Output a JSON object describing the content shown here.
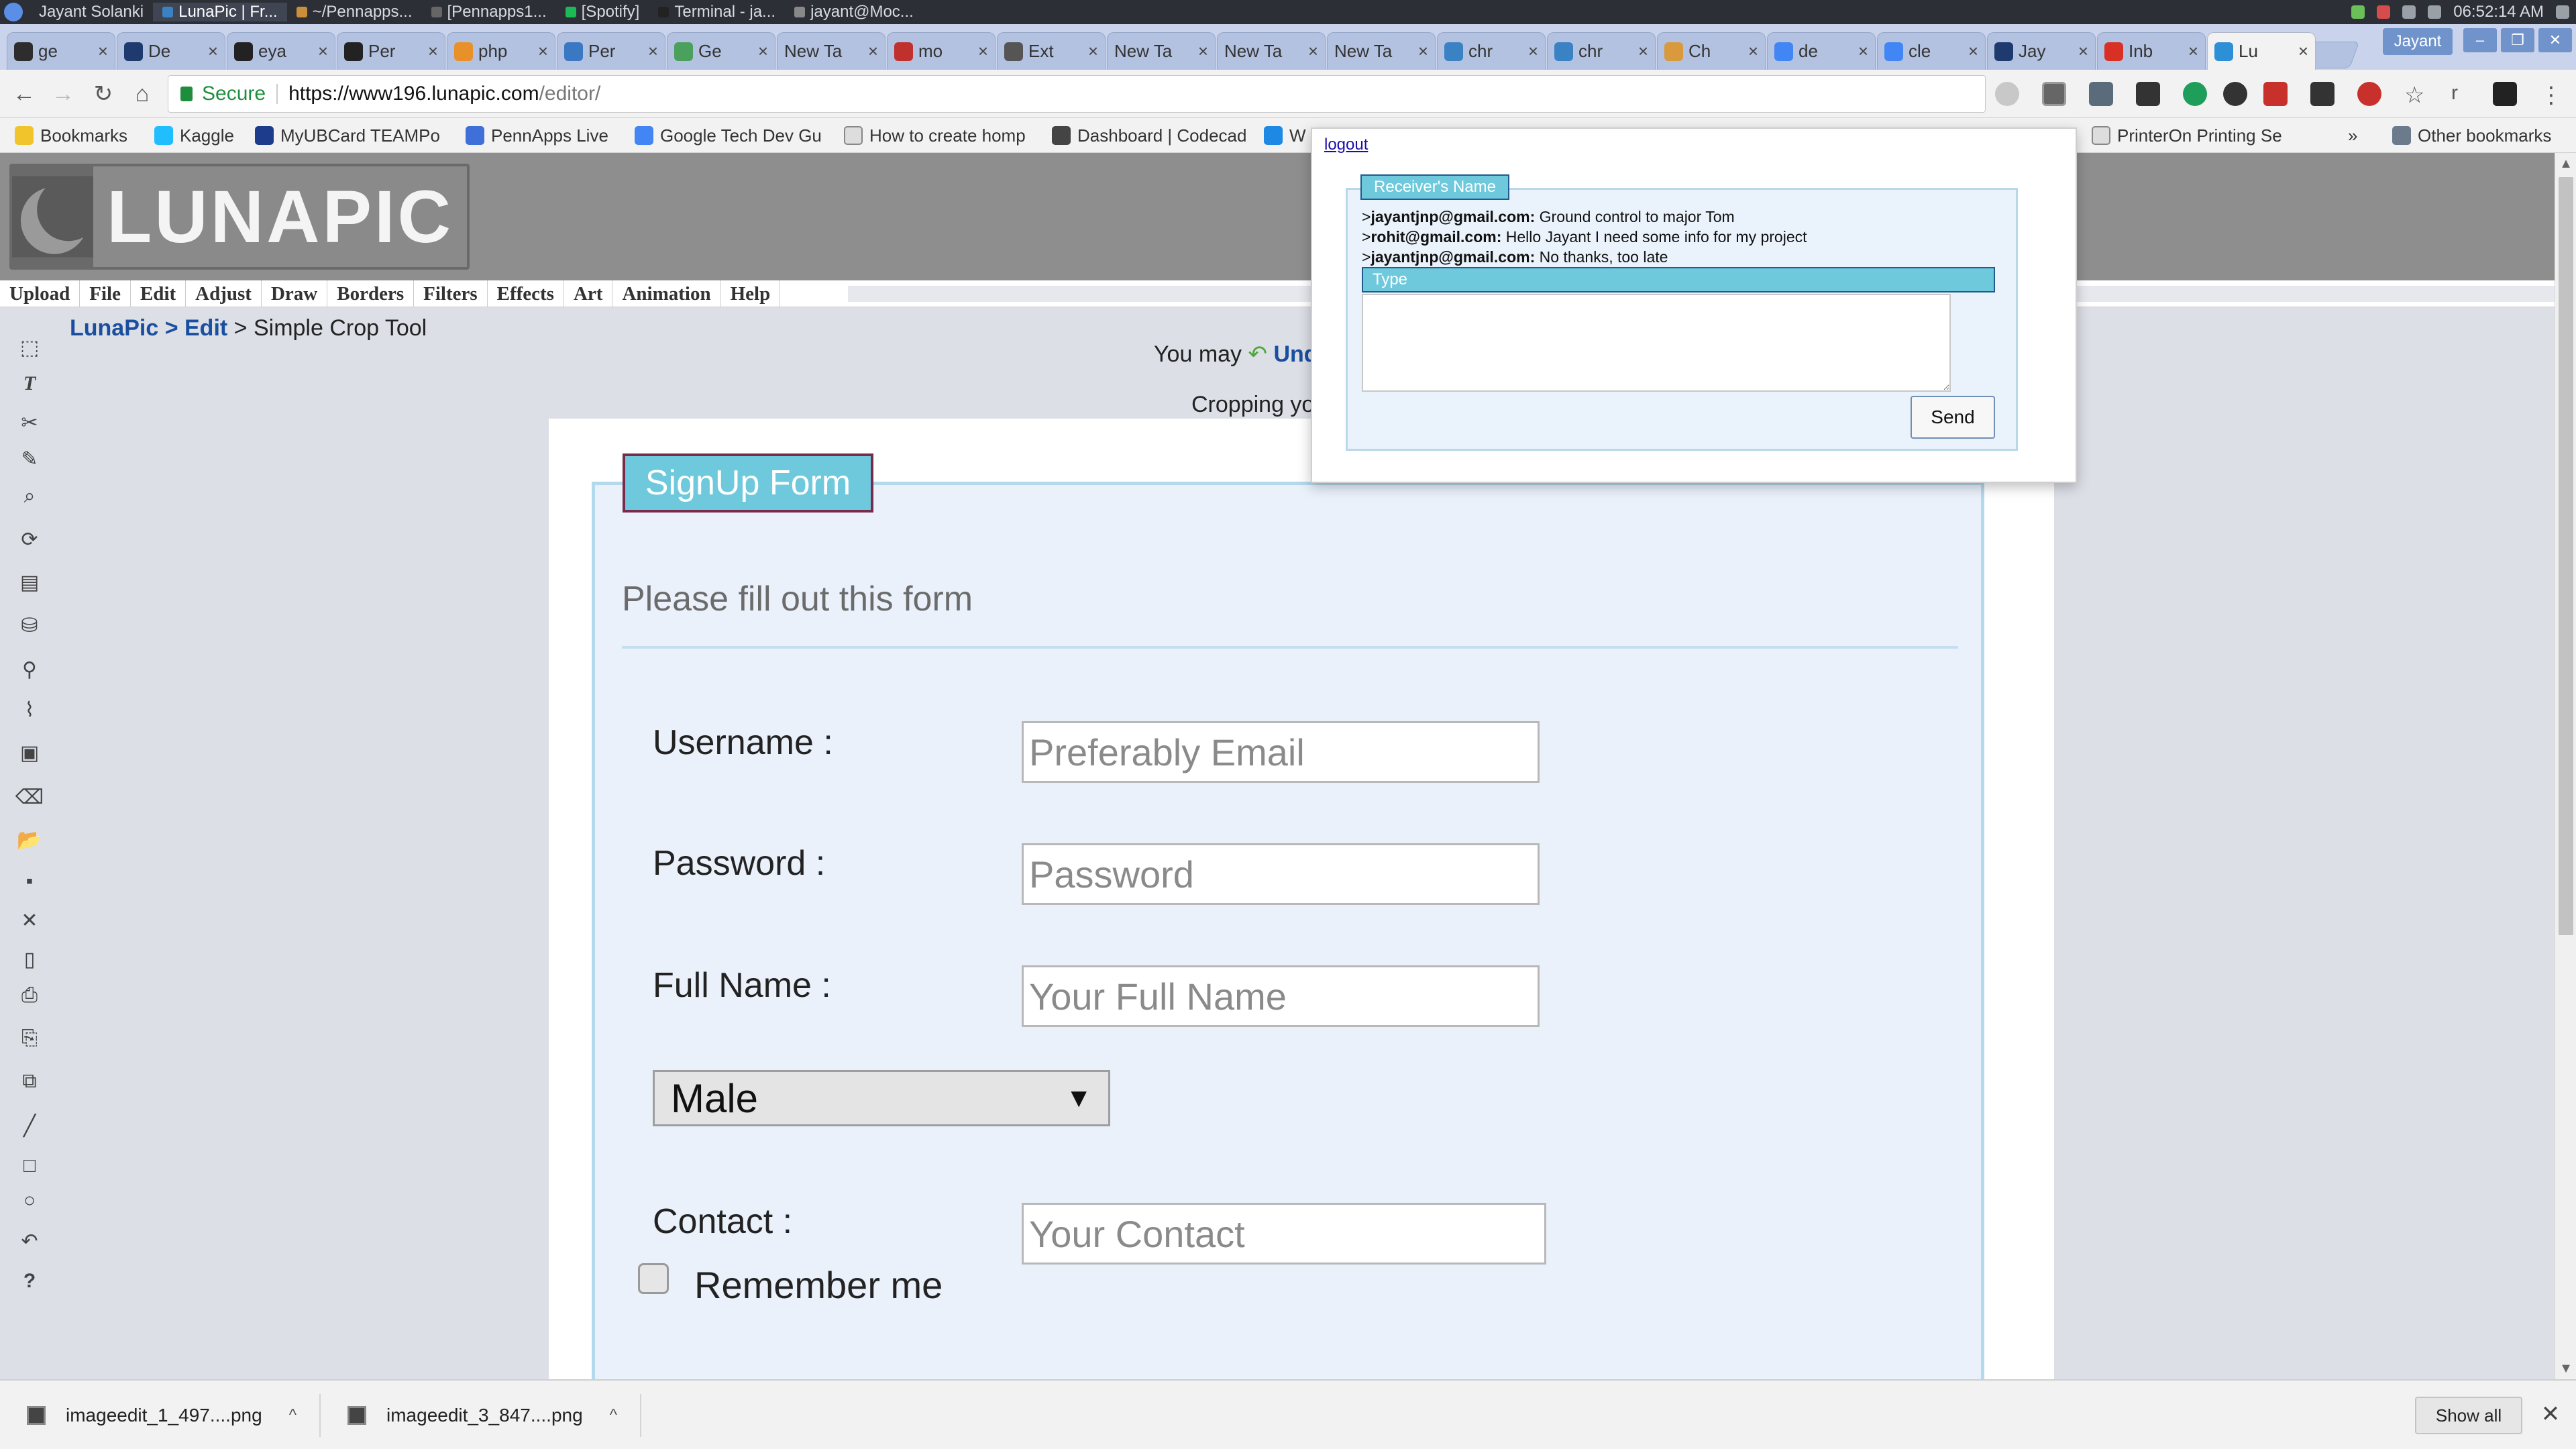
{
  "os": {
    "taskbar": [
      {
        "label": "Jayant Solanki",
        "active": false
      },
      {
        "label": "LunaPic | Fr...",
        "active": true
      },
      {
        "label": "~/Pennapps...",
        "active": false
      },
      {
        "label": "[Pennapps1...",
        "active": false
      },
      {
        "label": "[Spotify]",
        "active": false
      },
      {
        "label": "Terminal - ja...",
        "active": false
      },
      {
        "label": "jayant@Moc...",
        "active": false
      }
    ],
    "clock": "06:52:14 AM"
  },
  "tabs": [
    {
      "label": "ge",
      "icon": "hash-icon",
      "color": "#2d2d2d"
    },
    {
      "label": "De",
      "icon": "d-logo-icon",
      "color": "#1f3a6e"
    },
    {
      "label": "eya",
      "icon": "github-icon",
      "color": "#222222"
    },
    {
      "label": "Per",
      "icon": "github-icon",
      "color": "#222222"
    },
    {
      "label": "php",
      "icon": "php-icon",
      "color": "#e8912a"
    },
    {
      "label": "Per",
      "icon": "doc-icon",
      "color": "#3b78c4"
    },
    {
      "label": "Ge",
      "icon": "leaf-icon",
      "color": "#4aa05c"
    },
    {
      "label": "New Ta",
      "icon": "",
      "color": ""
    },
    {
      "label": "mo",
      "icon": "bookmark-icon",
      "color": "#c0302c"
    },
    {
      "label": "Ext",
      "icon": "puzzle-icon",
      "color": "#555555"
    },
    {
      "label": "New Ta",
      "icon": "",
      "color": ""
    },
    {
      "label": "New Ta",
      "icon": "",
      "color": ""
    },
    {
      "label": "New Ta",
      "icon": "",
      "color": ""
    },
    {
      "label": "chr",
      "icon": "chrome-icon",
      "color": "#3b82c4"
    },
    {
      "label": "chr",
      "icon": "chrome-icon",
      "color": "#3b82c4"
    },
    {
      "label": "Ch",
      "icon": "pencil-icon",
      "color": "#d89a3c"
    },
    {
      "label": "de",
      "icon": "google-icon",
      "color": "#4285f4"
    },
    {
      "label": "cle",
      "icon": "google-icon",
      "color": "#4285f4"
    },
    {
      "label": "Jay",
      "icon": "d-logo-icon",
      "color": "#1f3a6e"
    },
    {
      "label": "Inb",
      "icon": "gmail-icon",
      "color": "#d93025"
    },
    {
      "label": "Lu",
      "icon": "lunapic-icon",
      "color": "#2d8fd6"
    }
  ],
  "profile": "Jayant",
  "omnibox": {
    "secure_label": "Secure",
    "url_host": "https://www196.lunapic.com",
    "url_path": "/editor/"
  },
  "bookmarks": [
    {
      "label": "Bookmarks",
      "color": "#f2c42b"
    },
    {
      "label": "Kaggle",
      "color": "#20beff"
    },
    {
      "label": "MyUBCard TEAMPo",
      "color": "#1e3c8c"
    },
    {
      "label": "PennApps Live",
      "color": "#3f6fd8"
    },
    {
      "label": "Google Tech Dev Gu",
      "color": "#4285f4"
    },
    {
      "label": "How to create homp",
      "color": "#cccccc"
    },
    {
      "label": "Dashboard | Codecad",
      "color": "#444444"
    },
    {
      "label": "W",
      "color": "#1e88e5"
    },
    {
      "label": "PrinterOn Printing Se",
      "color": "#cccccc"
    },
    {
      "label": "»",
      "color": ""
    },
    {
      "label": "Other bookmarks",
      "color": "#6b7b8c"
    }
  ],
  "luna": {
    "logo_text": "LUNAPIC",
    "menu": [
      "Upload",
      "File",
      "Edit",
      "Adjust",
      "Draw",
      "Borders",
      "Filters",
      "Effects",
      "Art",
      "Animation",
      "Help"
    ],
    "breadcrumb": {
      "part1": "LunaPic",
      "sep1": " > ",
      "part2": "Edit",
      "sep2": " > ",
      "current": "Simple Crop Tool"
    },
    "undo_prefix": "You may ",
    "undo_link": "Und",
    "crop_text": "Cropping yo"
  },
  "form": {
    "legend": "SignUp Form",
    "subtitle": "Please fill out this form",
    "username_label": "Username :",
    "username_placeholder": "Preferably Email",
    "password_label": "Password :",
    "password_placeholder": "Password",
    "fullname_label": "Full Name :",
    "fullname_placeholder": "Your Full Name",
    "gender_selected": "Male",
    "contact_label": "Contact :",
    "contact_placeholder": "Your Contact",
    "remember_label": "Remember me"
  },
  "chat": {
    "logout": "logout",
    "receiver_label": "Receiver's Name",
    "messages": [
      {
        "sender": "jayantjnp@gmail.com:",
        "text": " Ground control to major Tom"
      },
      {
        "sender": "rohit@gmail.com:",
        "text": " Hello Jayant I need some info for my project"
      },
      {
        "sender": "jayantjnp@gmail.com:",
        "text": " No thanks, too late"
      }
    ],
    "type_label": "Type",
    "send_label": "Send"
  },
  "downloads": [
    {
      "name": "imageedit_1_497....png"
    },
    {
      "name": "imageedit_3_847....png"
    }
  ],
  "show_all": "Show all"
}
